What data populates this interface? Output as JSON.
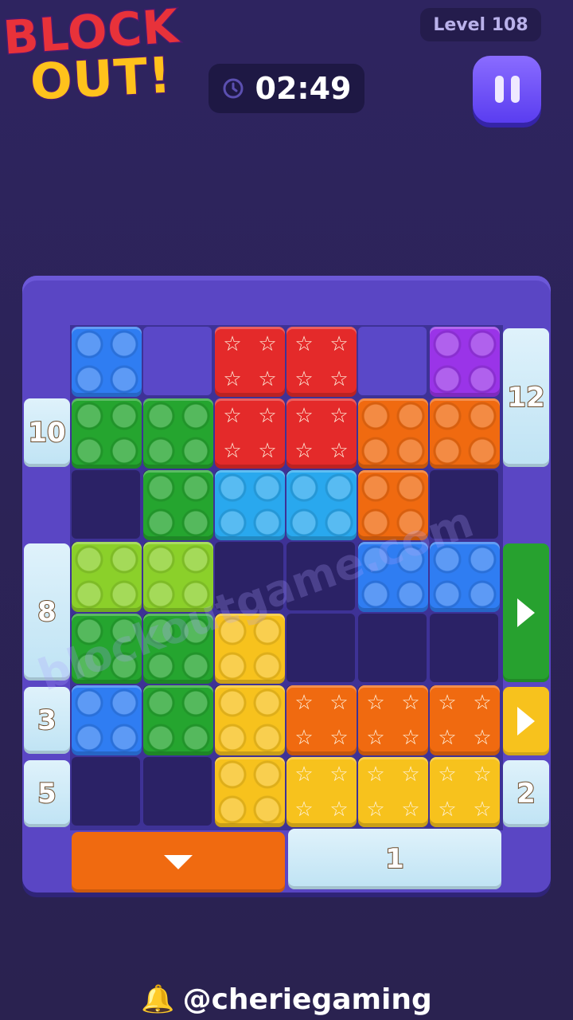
{
  "logo": {
    "line1": "BLOCK",
    "line2": "OUT!"
  },
  "header": {
    "level": "Level 108",
    "timer": "02:49"
  },
  "icons": {
    "clock": "clock-icon",
    "pause": "pause-icon",
    "bell": "bell-icon"
  },
  "doors": {
    "left_top": "10",
    "right_top": "12",
    "left_mid": "8",
    "left_3": "3",
    "left_5": "5",
    "right_2": "2",
    "bottom_1": "1"
  },
  "watermark": "blockoutgame.com",
  "footer": {
    "handle": "@cheriegaming"
  },
  "colors": {
    "background": "#2c2358",
    "frame": "#5a46c4",
    "blue": "#2f7df2",
    "green": "#25a52f",
    "lime": "#8bd02a",
    "red": "#e42a2a",
    "purple": "#9a34e8",
    "orange": "#f06a10",
    "cyan": "#29a8ee",
    "yellow": "#f7c21d"
  }
}
